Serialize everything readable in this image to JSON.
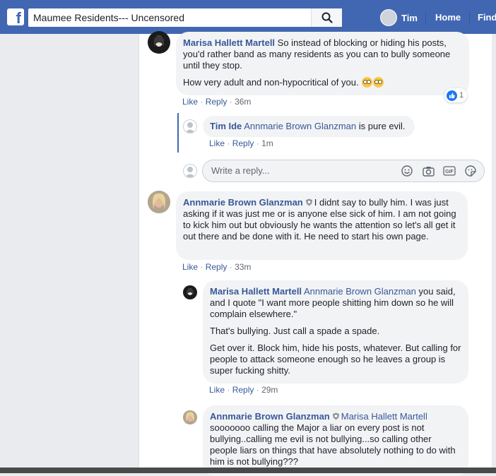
{
  "header": {
    "logo": "f",
    "search_value": "Maumee Residents--- Uncensored",
    "user_name": "Tim",
    "nav_home": "Home",
    "nav_find": "Find"
  },
  "comments": [
    {
      "author": "Marisa Hallett Martell",
      "paragraphs": [
        "So instead of blocking or hiding his posts, you'd rather band as many residents as you can to bully someone until they stop.",
        "How very adult and non-hypocritical of you."
      ],
      "like": "Like",
      "reply": "Reply",
      "time": "36m",
      "reaction_count": "1"
    },
    {
      "author": "Tim Ide",
      "tag": "Annmarie Brown Glanzman",
      "text": "is pure evil.",
      "like": "Like",
      "reply": "Reply",
      "time": "1m"
    },
    {
      "author": "Annmarie Brown Glanzman",
      "text": "I didnt say to bully him. I was just asking if it was just me or is anyone else sick of him. I am not going to kick him out but obviously he wants the attention so let's all get it out there and be done with it. He need to start his own page.",
      "like": "Like",
      "reply": "Reply",
      "time": "33m"
    },
    {
      "author": "Marisa Hallett Martell",
      "tag": "Annmarie Brown Glanzman",
      "paragraphs": [
        "you said, and I quote \"I want more people shitting him down so he will complain elsewhere.\"",
        "That's bullying. Just call a spade a spade.",
        "Get over it. Block him, hide his posts, whatever. But calling for people to attack someone enough so he leaves a group is super fucking shitty."
      ],
      "like": "Like",
      "reply": "Reply",
      "time": "29m"
    },
    {
      "author": "Annmarie Brown Glanzman",
      "tag": "Marisa Hallett Martell",
      "text": "sooooooo calling the Major a liar on every post is not bullying..calling me evil is not bullying...so calling other people liars on things that have absolutely nothing to do with him is not bullying???"
    }
  ],
  "reply_box": {
    "placeholder": "Write a reply..."
  },
  "colors": {
    "brand": "#4267b2",
    "link": "#385898",
    "bubble": "#f2f3f5"
  }
}
